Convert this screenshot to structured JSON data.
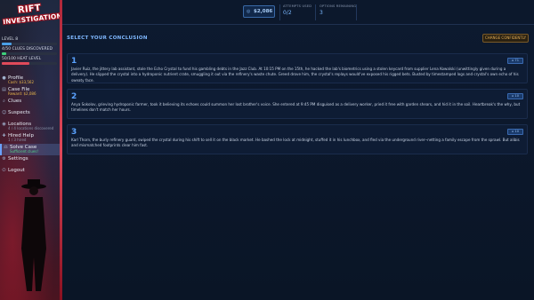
{
  "logo": {
    "line1": "RIFT",
    "line2": "INVESTIGATIONS"
  },
  "player": {
    "level": "LEVEL 8",
    "case_progress": "4/50 CLUES DISCOVERED",
    "heat": "50/100 HEAT LEVEL"
  },
  "nav": [
    {
      "name": "profile",
      "label": "Profile",
      "sub": "Cash: $33,562",
      "sub_class": "sub-gold",
      "icon": "user-icon",
      "glyph": "●"
    },
    {
      "name": "case-file",
      "label": "Case File",
      "sub": "Reward: $2,086",
      "sub_class": "sub-gold",
      "icon": "folder-icon",
      "glyph": "▤"
    },
    {
      "name": "clues",
      "label": "Clues",
      "sub": "",
      "sub_class": "sub-gray",
      "icon": "magnifier-icon",
      "glyph": "⌕"
    },
    {
      "name": "suspects",
      "label": "Suspects",
      "sub": "",
      "sub_class": "sub-gray",
      "icon": "users-icon",
      "glyph": "☺"
    },
    {
      "name": "locations",
      "label": "Locations",
      "sub": "4 / 4 locations discovered",
      "sub_class": "sub-gray",
      "icon": "pin-icon",
      "glyph": "◉"
    },
    {
      "name": "hired-help",
      "label": "Hired Help",
      "sub": "1 / 3 hired",
      "sub_class": "sub-gray",
      "icon": "handshake-icon",
      "glyph": "✚"
    },
    {
      "name": "solve-case",
      "label": "Solve Case",
      "sub": "Sufficient clues!",
      "sub_class": "sub-green",
      "icon": "gavel-icon",
      "glyph": "⚖"
    },
    {
      "name": "settings",
      "label": "Settings",
      "sub": "",
      "sub_class": "sub-gray",
      "icon": "gear-icon",
      "glyph": "⚙"
    },
    {
      "name": "logout",
      "label": "Logout",
      "sub": "",
      "sub_class": "sub-gray",
      "icon": "logout-icon",
      "glyph": "⏻"
    }
  ],
  "topbar": {
    "money": "$2,086",
    "attempts_label": "ATTEMPTS USED",
    "attempts_value": "0/2",
    "options_label": "OPTIONS REMAINING",
    "options_value": "3"
  },
  "main": {
    "title": "SELECT YOUR CONCLUSION",
    "change_button": "CHANGE CONFIDENTLY"
  },
  "conclusions": [
    {
      "number": "1",
      "tag": "71",
      "text": "Javier Ruiz, the jittery lab assistant, stole the Echo Crystal to fund his gambling debts in the Jazz Club. At 10:15 PM on the 15th, he hacked the lab's biometrics using a stolen keycard from supplier Lena Kowalski (unwittingly given during a delivery). He slipped the crystal into a hydroponic nutrient crate, smuggling it out via the refinery's waste chute. Greed drove him, the crystal's replays would've exposed his rigged bets. Busted by timestamped logs and crystal's own echo of his sweaty face."
    },
    {
      "number": "2",
      "tag": "10",
      "text": "Anya Sokolov, grieving hydroponic farmer, took it believing its echoes could summon her lost brother's voice. She entered at 9:45 PM disguised as a delivery worker, pried it free with garden shears, and hid it in the soil. Heartbreak's the why, but timelines don't match her hours."
    },
    {
      "number": "3",
      "tag": "10",
      "text": "Karl Thorn, the burly refinery guard, swiped the crystal during his shift to sell it on the black market. He bashed the lock at midnight, stuffed it in his lunchbox, and fled via the underground river--netting a family escape from the sprawl. But alibis and mismatched footprints clear him fast."
    }
  ]
}
